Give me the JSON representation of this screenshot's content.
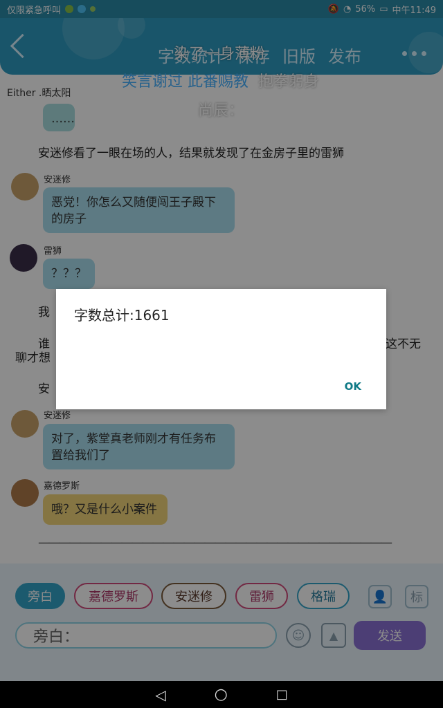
{
  "status": {
    "left_text": "仅限紧急呼叫",
    "right_text": "56%",
    "time": "中午11:49"
  },
  "header": {
    "tabs": [
      "字数统计",
      "保存",
      "旧版",
      "发布"
    ]
  },
  "overlay": {
    "line1": "染了一身薄粉",
    "line2_blue": "笑言谢过 此番赐教",
    "line2_white": "抱拳躬身",
    "line3": "尚辰："
  },
  "author": "Either .晒太阳",
  "chat": {
    "partial_bubble": "……",
    "narration1": "安迷修看了一眼在场的人，结果就发现了在金房子里的雷狮",
    "msgs": [
      {
        "name": "安迷修",
        "text": "恶党！你怎么又随便闯王子殿下的房子"
      },
      {
        "name": "雷狮",
        "text": "？？？"
      },
      {
        "name": "安迷修",
        "text": "对了，紫堂真老师刚才有任务布置给我们了"
      },
      {
        "name": "嘉德罗斯",
        "text": "哦？又是什么小案件"
      }
    ],
    "narration2": "我",
    "narration3": "谁",
    "narration3_right": "巴这不无",
    "narration3_line2": "聊才想",
    "narration4": "安",
    "divider": "——————————————————————————————————"
  },
  "dialog": {
    "title": "字数总计:1661",
    "ok": "OK"
  },
  "roles": [
    "旁白",
    "嘉德罗斯",
    "安迷修",
    "雷狮",
    "格瑞"
  ],
  "input_placeholder": "旁白：",
  "send_label": "发送",
  "tag_button": "标"
}
